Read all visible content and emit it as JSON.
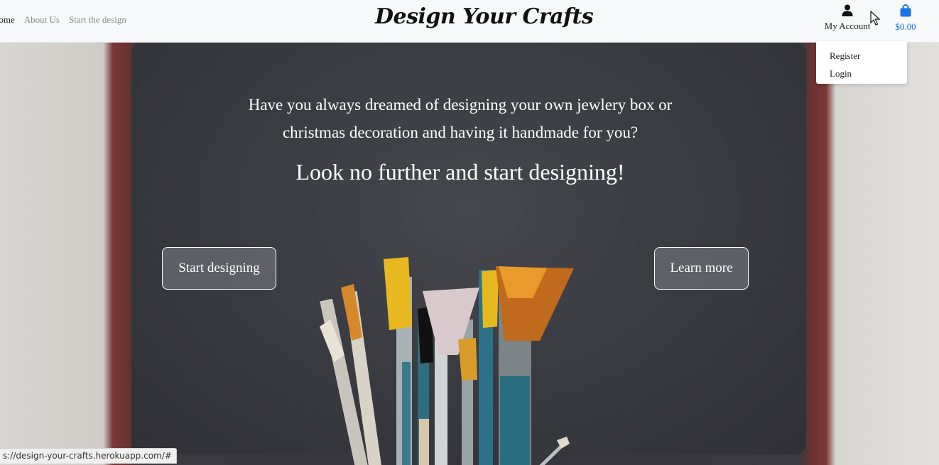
{
  "nav": {
    "home": "Home",
    "about": "About Us",
    "start": "Start the design"
  },
  "brand": "Design Your Crafts",
  "account": {
    "label": "My Account",
    "icon": "user-icon"
  },
  "bag": {
    "total": "$0.00",
    "icon": "shopping-bag-icon",
    "color": "#1a73e8"
  },
  "dropdown": {
    "register": "Register",
    "login": "Login"
  },
  "hero": {
    "lead_line1": "Have you always dreamed of designing your own jewlery box or",
    "lead_line2": "christmas decoration and having it handmade for you?",
    "cta": "Look no further and start designing!",
    "start_button": "Start designing",
    "learn_button": "Learn more"
  },
  "status_url": "s://design-your-crafts.herokuapp.com/#"
}
